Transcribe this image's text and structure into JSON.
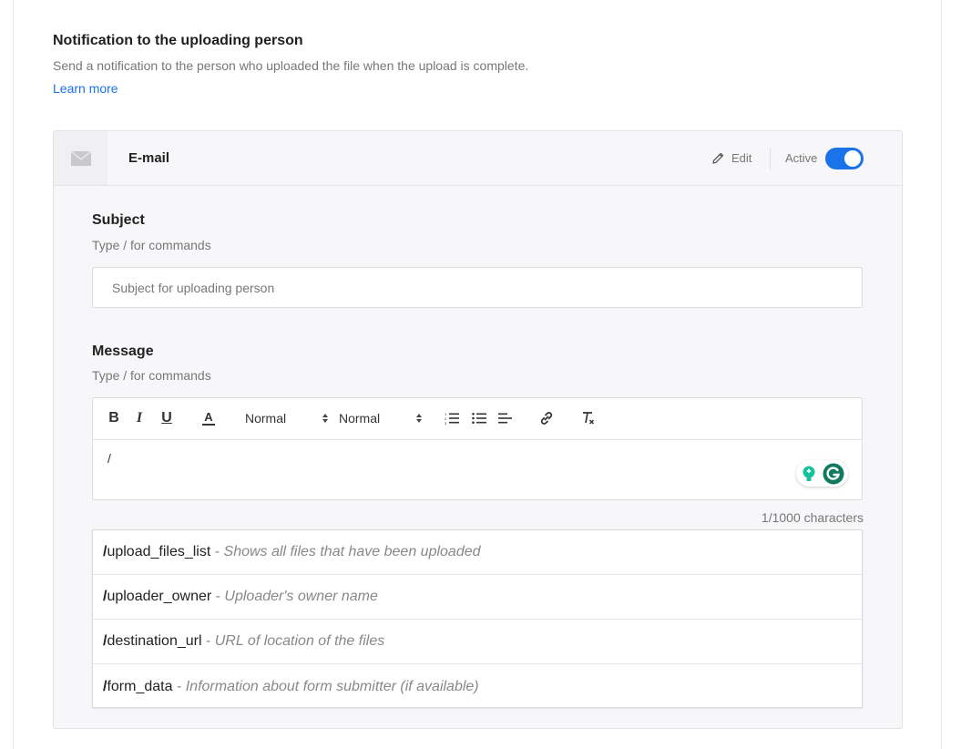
{
  "section": {
    "title": "Notification to the uploading person",
    "description": "Send a notification to the person who uploaded the file when the upload is complete.",
    "learn_more": "Learn more"
  },
  "card": {
    "icon": "mail-icon",
    "title": "E-mail",
    "edit_label": "Edit",
    "active_label": "Active",
    "active": true,
    "accent_color": "#1a73e8"
  },
  "subject": {
    "label": "Subject",
    "hint": "Type / for commands",
    "placeholder": "Subject for uploading person",
    "value": ""
  },
  "message": {
    "label": "Message",
    "hint": "Type / for commands",
    "toolbar": {
      "bold": "B",
      "italic": "I",
      "underline": "U",
      "text_color": "A",
      "font_size": "Normal",
      "heading": "Normal"
    },
    "content": "/",
    "char_count": "1/1000 characters"
  },
  "commands": [
    {
      "slash": "/",
      "name": "upload_files_list",
      "sep": " - ",
      "desc": "Shows all files that have been uploaded"
    },
    {
      "slash": "/",
      "name": "uploader_owner",
      "sep": " - ",
      "desc": "Uploader's owner name"
    },
    {
      "slash": "/",
      "name": "destination_url",
      "sep": " - ",
      "desc": "URL of location of the files"
    },
    {
      "slash": "/",
      "name": "form_data",
      "sep": " - ",
      "desc": "Information about form submitter (if available)"
    }
  ]
}
